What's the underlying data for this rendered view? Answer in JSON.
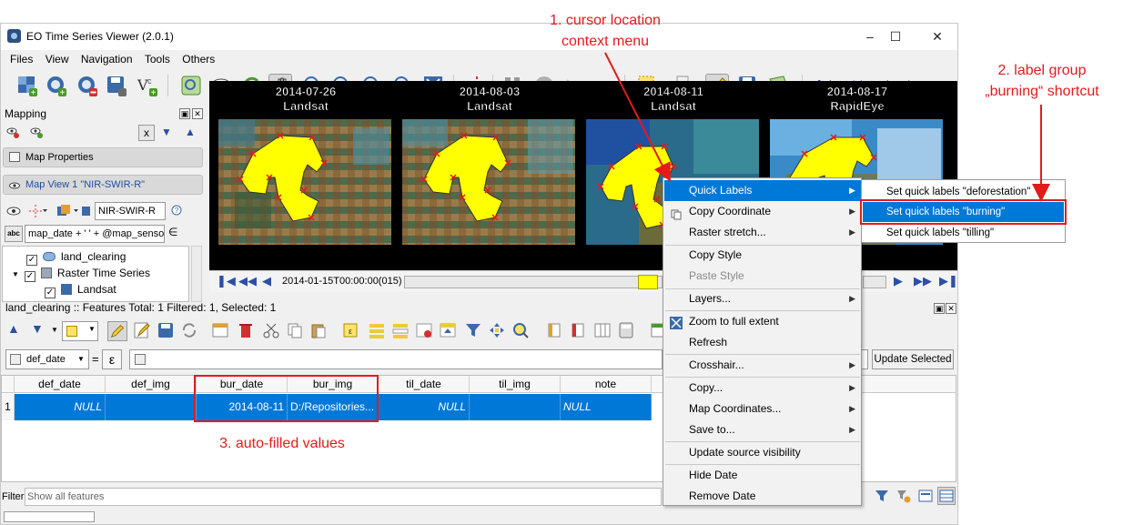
{
  "window": {
    "title": "EO Time Series Viewer (2.0.1)",
    "menu": [
      "Files",
      "View",
      "Navigation",
      "Tools",
      "Others"
    ]
  },
  "mapping_panel": {
    "title": "Mapping",
    "map_properties": "Map Properties",
    "map_view": "Map View 1 \"NIR-SWIR-R\"",
    "band_combo": "NIR-SWIR-R",
    "label_expression": "map_date + ' ' + @map_sensor",
    "close_x": "x",
    "tree": [
      {
        "label": "land_clearing",
        "checked": true
      },
      {
        "label": "Raster Time Series",
        "checked": true
      },
      {
        "label": "Landsat",
        "checked": true
      }
    ]
  },
  "map_views": [
    {
      "date": "2014-07-26",
      "sensor": "Landsat"
    },
    {
      "date": "2014-08-03",
      "sensor": "Landsat"
    },
    {
      "date": "2014-08-11",
      "sensor": "Landsat"
    },
    {
      "date": "2014-08-17",
      "sensor": "RapidEye"
    }
  ],
  "time_navigation": {
    "current": "2014-01-15T00:00:00(015)"
  },
  "attribute_table": {
    "title": "land_clearing :: Features Total: 1 Filtered: 1, Selected: 1",
    "field_combo": "def_date",
    "equals": "=",
    "epsilon": "ε",
    "update_selected": "Update Selected",
    "columns": [
      "def_date",
      "def_img",
      "bur_date",
      "bur_img",
      "til_date",
      "til_img",
      "note"
    ],
    "rows": [
      {
        "index": "1",
        "cells": [
          "NULL",
          "",
          "2014-08-11",
          "D:/Repositories...",
          "NULL",
          "",
          "NULL"
        ]
      }
    ],
    "filter_label": "Filter",
    "filter_value": "Show all features"
  },
  "context_menu": {
    "items": [
      {
        "label": "Quick Labels",
        "submenu": true,
        "highlighted": true
      },
      {
        "label": "Copy Coordinate",
        "submenu": true,
        "icon": "copy-icon"
      },
      {
        "label": "Raster stretch...",
        "submenu": true
      },
      {
        "label": "Copy Style"
      },
      {
        "label": "Paste Style",
        "disabled": true
      },
      {
        "label": "Layers...",
        "submenu": true
      },
      {
        "label": "Zoom to full extent",
        "icon": "zoom-full-icon"
      },
      {
        "label": "Refresh"
      },
      {
        "label": "Crosshair...",
        "submenu": true
      },
      {
        "label": "Copy...",
        "submenu": true
      },
      {
        "label": "Map Coordinates...",
        "submenu": true
      },
      {
        "label": "Save to...",
        "submenu": true
      },
      {
        "label": "Update source visibility"
      },
      {
        "label": "Hide Date"
      },
      {
        "label": "Remove Date"
      }
    ],
    "submenu": [
      {
        "label": "Set quick labels \"deforestation\""
      },
      {
        "label": "Set quick labels \"burning\"",
        "highlighted": true
      },
      {
        "label": "Set quick labels \"tilling\""
      }
    ]
  },
  "annotations": {
    "cursor_line1": "1. cursor location",
    "cursor_line2": "context menu",
    "group_line1": "2. label group",
    "group_line2": "„burning“ shortcut",
    "autofill": "3. auto-filled values",
    "color": "#e31b1b"
  },
  "colors": {
    "selection": "#0078d7",
    "polygon_fill": "#ffff00",
    "vertex_marker": "#e31b1b",
    "map_background": "#000000"
  }
}
